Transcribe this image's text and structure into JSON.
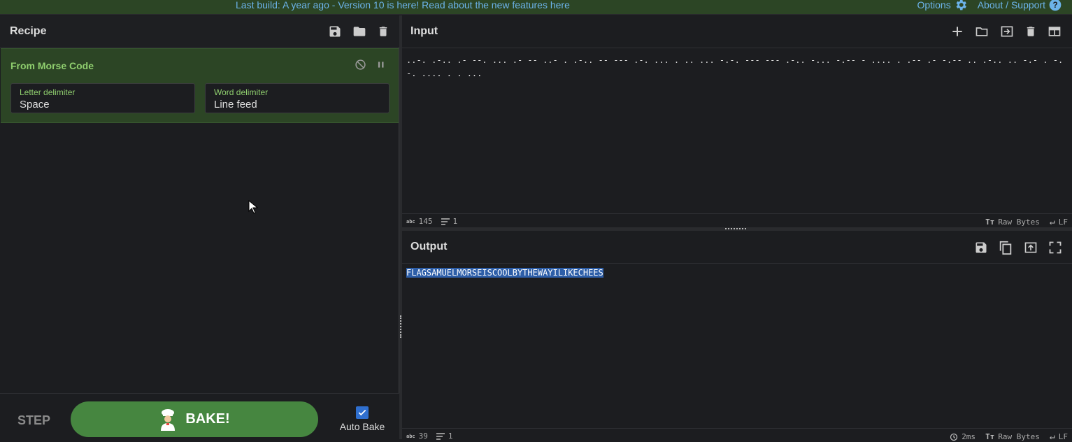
{
  "banner": {
    "message": "Last build: A year ago - Version 10 is here! Read about the new features here",
    "options_label": "Options",
    "about_label": "About / Support"
  },
  "recipe": {
    "title": "Recipe",
    "operation": {
      "name": "From Morse Code",
      "args": [
        {
          "label": "Letter delimiter",
          "value": "Space"
        },
        {
          "label": "Word delimiter",
          "value": "Line feed"
        }
      ]
    },
    "step_label": "STEP",
    "bake_label": "BAKE!",
    "autobake_label": "Auto Bake",
    "autobake_checked": true
  },
  "input": {
    "title": "Input",
    "text": "..-. .-.. .- --. ... .- -- ..- . .-.. -- --- .-. ... . .. ... -.-. --- --- .-.. -... -.-- - .... . .-- .- -.-- .. .-.. .. -.- . -.-. .... . . ...",
    "status": {
      "chars": "145",
      "lines": "1",
      "encoding": "Raw Bytes",
      "eol": "LF"
    }
  },
  "output": {
    "title": "Output",
    "text": "FLAGSAMUELMORSEISCOOLBYTHEWAYILIKECHEES",
    "status": {
      "chars": "39",
      "lines": "1",
      "time": "2ms",
      "encoding": "Raw Bytes",
      "eol": "LF"
    }
  },
  "colors": {
    "accent_green": "#468640",
    "op_green": "#8fce6e",
    "link_blue": "#6cb3ea",
    "selection": "#2d5ea8"
  }
}
